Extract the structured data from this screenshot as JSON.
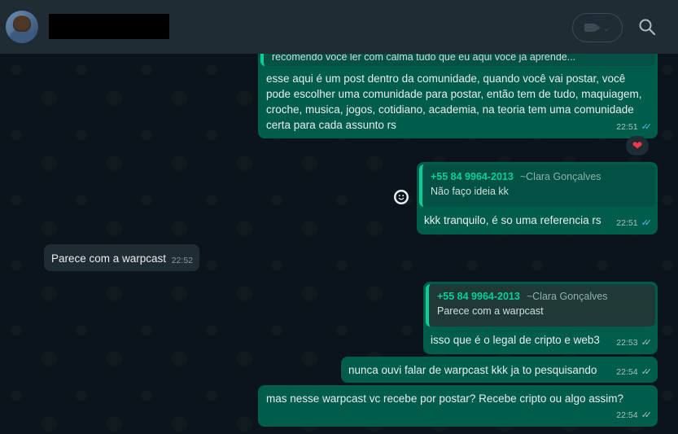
{
  "header": {
    "video_chevron": "⌄"
  },
  "messages": {
    "m1": {
      "quote_text": "recomendo você ler com calma tudo que eu aqui você já aprende...",
      "text": "esse aqui é um post dentro da comunidade, quando você vai postar, você pode escolher uma comunidade para postar, então tem de tudo, maquiagem, croche, musica, jogos, cotidiano, academia, na teoria tem uma comunidade certa para cada assunto rs",
      "time": "22:51",
      "reaction": "❤"
    },
    "m2": {
      "quote_phone": "+55 84 9964-2013",
      "quote_name": "~Clara Gonçalves",
      "quote_text": "Não faço ideia kk",
      "text": "kkk tranquilo, é so uma referencia rs",
      "time": "22:51"
    },
    "m3": {
      "text": "Parece com a warpcast",
      "time": "22:52"
    },
    "m4": {
      "quote_phone": "+55 84 9964-2013",
      "quote_name": "~Clara Gonçalves",
      "quote_text": "Parece com a warpcast",
      "text": "isso que é o legal de cripto e web3",
      "time": "22:53"
    },
    "m5": {
      "text": "nunca ouvi falar de warpcast kkk ja to pesquisando",
      "time": "22:54"
    },
    "m6": {
      "text": "mas nesse warpcast vc recebe por postar? Recebe cripto ou algo assim?",
      "time": "22:54"
    }
  },
  "ticks": "✓✓",
  "colors": {
    "outgoing_bubble": "#005c4b",
    "incoming_bubble": "#202c33",
    "read_ticks": "#53bdeb",
    "quote_accent": "#06cf9c"
  }
}
